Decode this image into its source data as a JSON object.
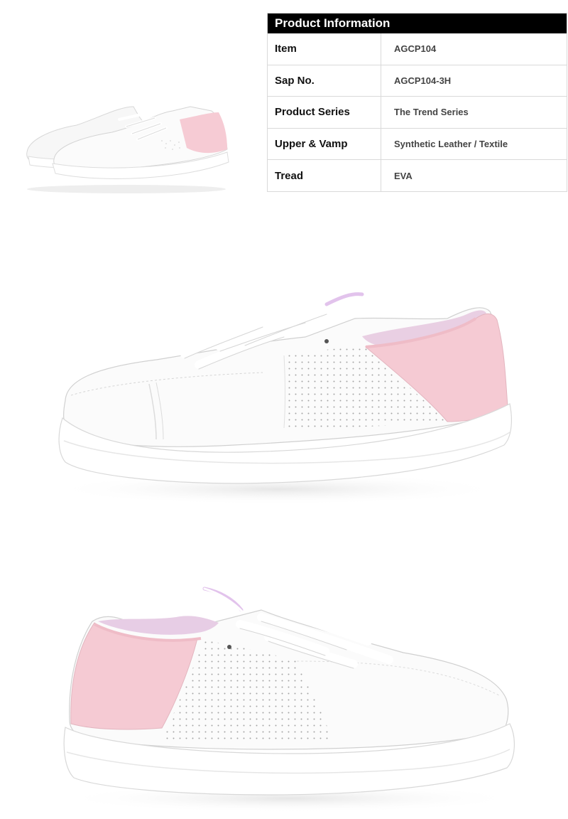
{
  "product_info": {
    "title": "Product Information",
    "rows": [
      {
        "label": "Item",
        "value": "AGCP104"
      },
      {
        "label": "Sap No.",
        "value": "AGCP104-3H"
      },
      {
        "label": "Product Series",
        "value": "The Trend Series"
      },
      {
        "label": "Upper & Vamp",
        "value": "Synthetic Leather / Textile"
      },
      {
        "label": "Tread",
        "value": "EVA"
      }
    ]
  },
  "colors": {
    "upper": "#fafafa",
    "heel_pink": "#f3c9d2",
    "sole": "#ffffff",
    "table_header": "#000000",
    "table_border": "#d9d9d9"
  }
}
